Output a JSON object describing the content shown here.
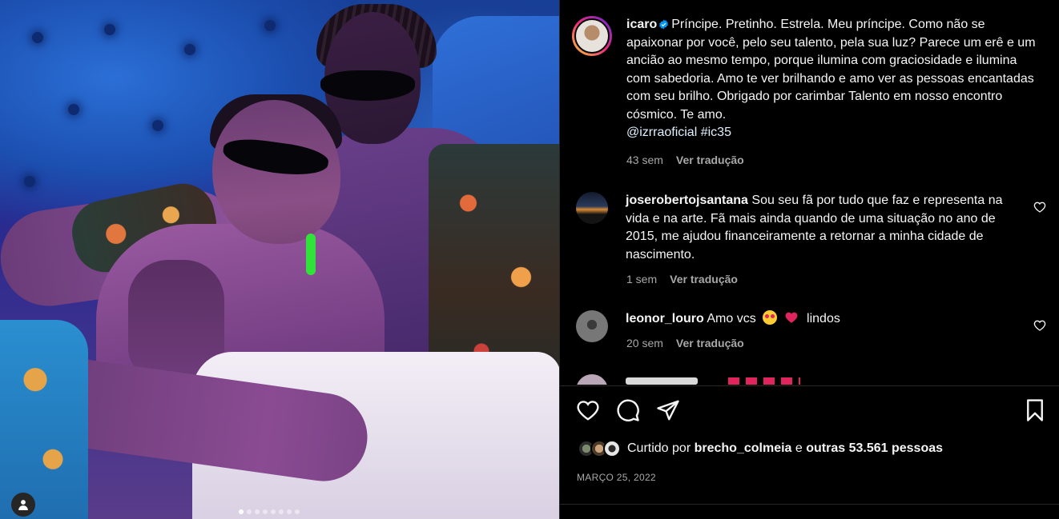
{
  "post": {
    "carousel": {
      "count": 8,
      "active_index": 0
    }
  },
  "caption": {
    "username": "icaro",
    "text": "Príncipe. Pretinho. Estrela. Meu príncipe. Como não se apaixonar por você, pelo seu talento, pela sua luz? Parece um erê e um ancião ao mesmo tempo, porque ilumina com graciosidade e ilumina com sabedoria. Amo te ver brilhando e amo ver as pessoas encantadas com seu brilho. Obrigado por carimbar Talento em nosso encontro cósmico. Te amo.",
    "mention": "@izrraoficial",
    "hashtag": "#ic35",
    "time": "43 sem",
    "translate": "Ver tradução"
  },
  "comments": [
    {
      "username": "joserobertojsantana",
      "text": "Sou seu fã por tudo que faz e representa na vida e na arte. Fã mais ainda quando de uma situação no ano de 2015, me ajudou financeiramente a retornar a minha cidade de nascimento.",
      "time": "1 sem",
      "translate": "Ver tradução"
    },
    {
      "username": "leonor_louro",
      "text_before": "Amo vcs",
      "text_after": "lindos",
      "time": "20 sem",
      "translate": "Ver tradução"
    }
  ],
  "likes": {
    "prefix": "Curtido por",
    "user": "brecho_colmeia",
    "joiner": "e",
    "others": "outras 53.561 pessoas"
  },
  "date": "MARÇO 25, 2022",
  "icons": {
    "like": "heart-icon",
    "comment": "comment-icon",
    "share": "share-icon",
    "save": "bookmark-icon",
    "verified": "verified-badge-icon",
    "tag": "user-tag-icon"
  },
  "colors": {
    "background": "#000000",
    "text": "#f5f5f5",
    "secondary": "#a8a8a8",
    "verified": "#0095f6",
    "heart_emoji": "#e0245e"
  }
}
